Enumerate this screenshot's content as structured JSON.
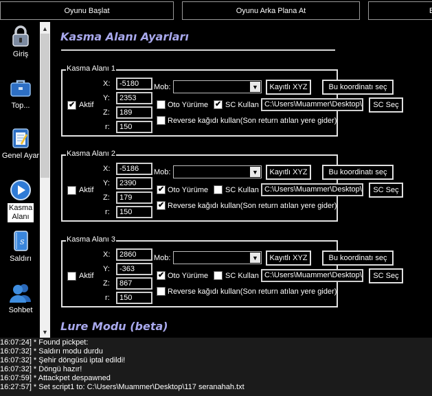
{
  "topbar": {
    "start_label": "Oyunu Başlat",
    "background_label": "Oyunu Arka Plana At",
    "third_label": "B"
  },
  "sidebar": {
    "items": [
      {
        "label": "Giriş",
        "icon": "lock-icon"
      },
      {
        "label": "Top...",
        "icon": "briefcase-icon"
      },
      {
        "label": "Genel Ayar",
        "icon": "notepad-icon"
      },
      {
        "label": "Kasma Alanı",
        "icon": "play-icon",
        "selected": true
      },
      {
        "label": "Saldırı",
        "icon": "book-icon"
      },
      {
        "label": "Sohbet",
        "icon": "users-icon"
      }
    ]
  },
  "main": {
    "title": "Kasma Alanı Ayarları",
    "lure_title": "Lure Modu (beta)",
    "groups": [
      {
        "title": "Kasma Alanı 1",
        "aktif_label": "Aktif",
        "aktif": true,
        "x_label": "X:",
        "x": "-5180",
        "y_label": "Y:",
        "y": "2353",
        "z_label": "Z:",
        "z": "189",
        "r_label": "r:",
        "r": "150",
        "mob_label": "Mob:",
        "mob_value": "",
        "kayitli_label": "Kayıtlı XYZ",
        "koordinat_label": "Bu koordinatı seç",
        "oto_label": "Oto Yürüme",
        "oto": false,
        "sc_label": "SC Kullan",
        "sc": true,
        "path": "C:\\Users\\Muammer\\Desktop\\",
        "sc_sec_label": "SC Seç",
        "reverse_label": "Reverse kağıdı kullan(Son return atılan yere gider)",
        "reverse": false
      },
      {
        "title": "Kasma Alanı 2",
        "aktif_label": "Aktif",
        "aktif": false,
        "x_label": "X:",
        "x": "-5186",
        "y_label": "Y:",
        "y": "2390",
        "z_label": "Z:",
        "z": "179",
        "r_label": "r:",
        "r": "150",
        "mob_label": "Mob:",
        "mob_value": "",
        "kayitli_label": "Kayıtlı XYZ",
        "koordinat_label": "Bu koordinatı seç",
        "oto_label": "Oto Yürüme",
        "oto": true,
        "sc_label": "SC Kullan",
        "sc": false,
        "path": "C:\\Users\\Muammer\\Desktop\\s",
        "sc_sec_label": "SC Seç",
        "reverse_label": "Reverse kağıdı kullan(Son return atılan yere gider)",
        "reverse": true
      },
      {
        "title": "Kasma Alanı 3",
        "aktif_label": "Aktif",
        "aktif": false,
        "x_label": "X:",
        "x": "2860",
        "y_label": "Y:",
        "y": "-363",
        "z_label": "Z:",
        "z": "867",
        "r_label": "r:",
        "r": "150",
        "mob_label": "Mob:",
        "mob_value": "",
        "kayitli_label": "Kayıtlı XYZ",
        "koordinat_label": "Bu koordinatı seç",
        "oto_label": "Oto Yürüme",
        "oto": true,
        "sc_label": "SC Kullan",
        "sc": false,
        "path": "C:\\Users\\Muammer\\Desktop\\s",
        "sc_sec_label": "SC Seç",
        "reverse_label": "Reverse kağıdı kullan(Son return atılan yere gider)",
        "reverse": false
      }
    ]
  },
  "log": {
    "lines": [
      "16:07:24] * Found pickpet:",
      "16:07:32] * Saldırı modu durdu",
      "16:07:32] * Şehir döngüsü iptal edildi!",
      "16:07:32] * Döngü hazır!",
      "16:07:59] * Attackpet despawned",
      "16:27:57] * Set script1 to: C:\\Users\\Muammer\\Desktop\\117 seranahah.txt"
    ]
  },
  "colors": {
    "heading": "#a8a8ec",
    "border": "#e4e4e4",
    "log_bg": "#1b1b1b",
    "icon_blue": "#3f8ee0"
  }
}
